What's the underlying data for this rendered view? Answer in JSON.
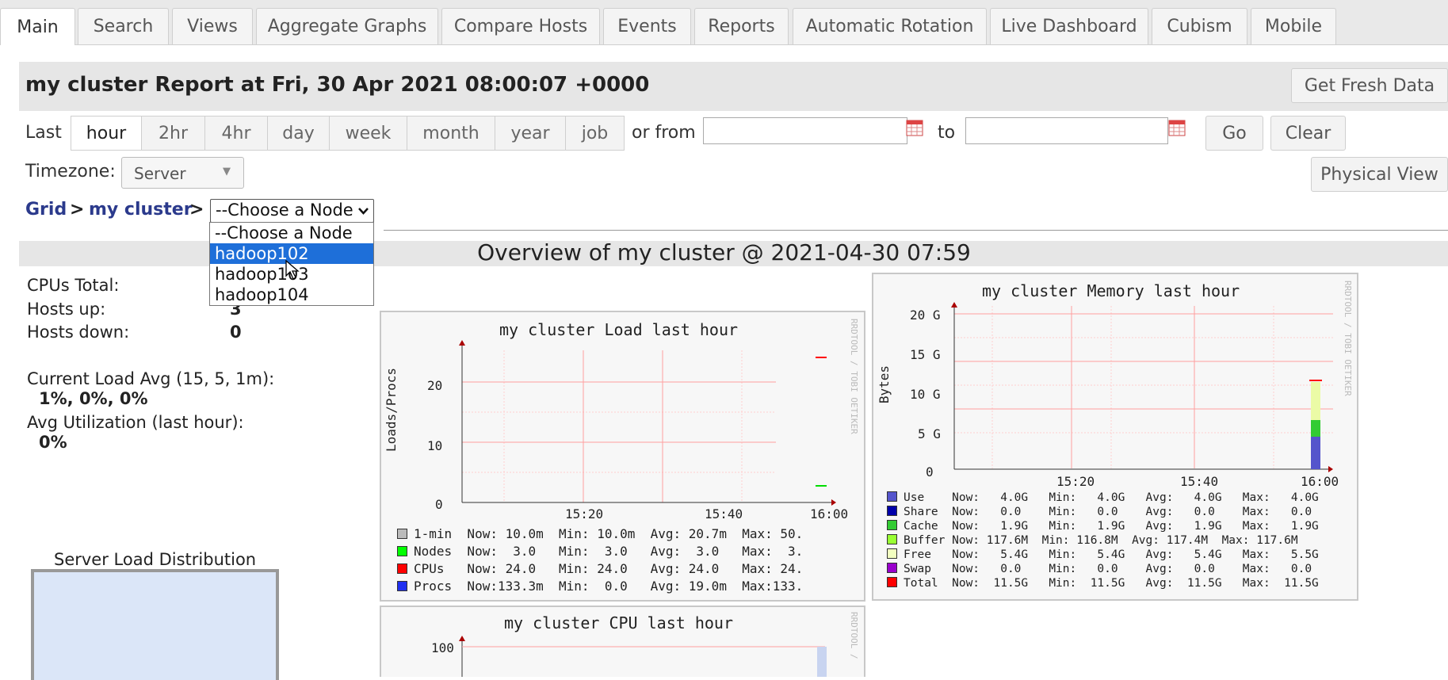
{
  "tabs": [
    "Main",
    "Search",
    "Views",
    "Aggregate Graphs",
    "Compare Hosts",
    "Events",
    "Reports",
    "Automatic Rotation",
    "Live Dashboard",
    "Cubism",
    "Mobile"
  ],
  "header": {
    "title": "my cluster Report at Fri, 30 Apr 2021 08:00:07 +0000",
    "fresh_button": "Get Fresh Data"
  },
  "range": {
    "last_label": "Last",
    "options": [
      "hour",
      "2hr",
      "4hr",
      "day",
      "week",
      "month",
      "year",
      "job"
    ],
    "active": "hour",
    "or_from_label": "or from",
    "to_label": "to",
    "go_button": "Go",
    "clear_button": "Clear"
  },
  "timezone": {
    "label": "Timezone:",
    "value": "Server"
  },
  "physical_view_button": "Physical View",
  "breadcrumb": {
    "grid": "Grid",
    "sep": ">",
    "cluster": "my cluster"
  },
  "node_select": {
    "value": "--Choose a Node",
    "options": [
      "--Choose a Node",
      "hadoop102",
      "hadoop103",
      "hadoop104"
    ],
    "highlighted": "hadoop102"
  },
  "overview": {
    "title": "Overview of my cluster @ 2021-04-30 07:59"
  },
  "stats": {
    "cpus_total_label": "CPUs Total:",
    "hosts_up_label": "Hosts up:",
    "hosts_up_value": "3",
    "hosts_down_label": "Hosts down:",
    "hosts_down_value": "0",
    "load_label": "Current Load Avg (15, 5, 1m):",
    "load_value": "1%, 0%, 0%",
    "util_label": "Avg Utilization (last hour):",
    "util_value": "0%"
  },
  "server_load": {
    "title": "Server Load Distribution"
  },
  "load_graph": {
    "title": "my cluster Load last hour",
    "ylabel": "Loads/Procs",
    "yticks": [
      "20",
      "10",
      "0"
    ],
    "xticks": [
      "15:20",
      "15:40",
      "16:00"
    ],
    "watermark": "RRDTOOL / TOBI OETIKER",
    "legend": [
      {
        "name": "1-min",
        "color": "#bbbbbb",
        "text": "1-min  Now: 10.0m  Min: 10.0m  Avg: 20.7m  Max: 50."
      },
      {
        "name": "Nodes",
        "color": "#00ff00",
        "text": "Nodes  Now:  3.0   Min:  3.0   Avg:  3.0   Max:  3."
      },
      {
        "name": "CPUs",
        "color": "#ff0000",
        "text": "CPUs   Now: 24.0   Min: 24.0   Avg: 24.0   Max: 24."
      },
      {
        "name": "Procs",
        "color": "#2030f0",
        "text": "Procs  Now:133.3m  Min:  0.0   Avg: 19.0m  Max:133."
      }
    ]
  },
  "memory_graph": {
    "title": "my cluster Memory last hour",
    "ylabel": "Bytes",
    "yticks": [
      "20 G",
      "15 G",
      "10 G",
      "5 G",
      "0"
    ],
    "xticks": [
      "15:20",
      "15:40",
      "16:00"
    ],
    "watermark": "RRDTOOL / TOBI OETIKER",
    "legend": [
      {
        "name": "Use",
        "color": "#5555cc",
        "text": "Use    Now:   4.0G   Min:   4.0G   Avg:   4.0G   Max:   4.0G"
      },
      {
        "name": "Share",
        "color": "#0000aa",
        "text": "Share  Now:   0.0    Min:   0.0    Avg:   0.0    Max:   0.0"
      },
      {
        "name": "Cache",
        "color": "#33cc33",
        "text": "Cache  Now:   1.9G   Min:   1.9G   Avg:   1.9G   Max:   1.9G"
      },
      {
        "name": "Buffer",
        "color": "#99ff33",
        "text": "Buffer Now: 117.6M  Min: 116.8M  Avg: 117.4M  Max: 117.6M"
      },
      {
        "name": "Free",
        "color": "#f2ffc0",
        "text": "Free   Now:   5.4G   Min:   5.4G   Avg:   5.4G   Max:   5.5G"
      },
      {
        "name": "Swap",
        "color": "#9900cc",
        "text": "Swap   Now:   0.0    Min:   0.0    Avg:   0.0    Max:   0.0"
      },
      {
        "name": "Total",
        "color": "#ff0000",
        "text": "Total  Now:  11.5G   Min:  11.5G   Avg:  11.5G   Max:  11.5G"
      }
    ]
  },
  "cpu_graph": {
    "title": "my cluster CPU last hour",
    "ytick": "100",
    "watermark": "RRDTOOL /"
  }
}
